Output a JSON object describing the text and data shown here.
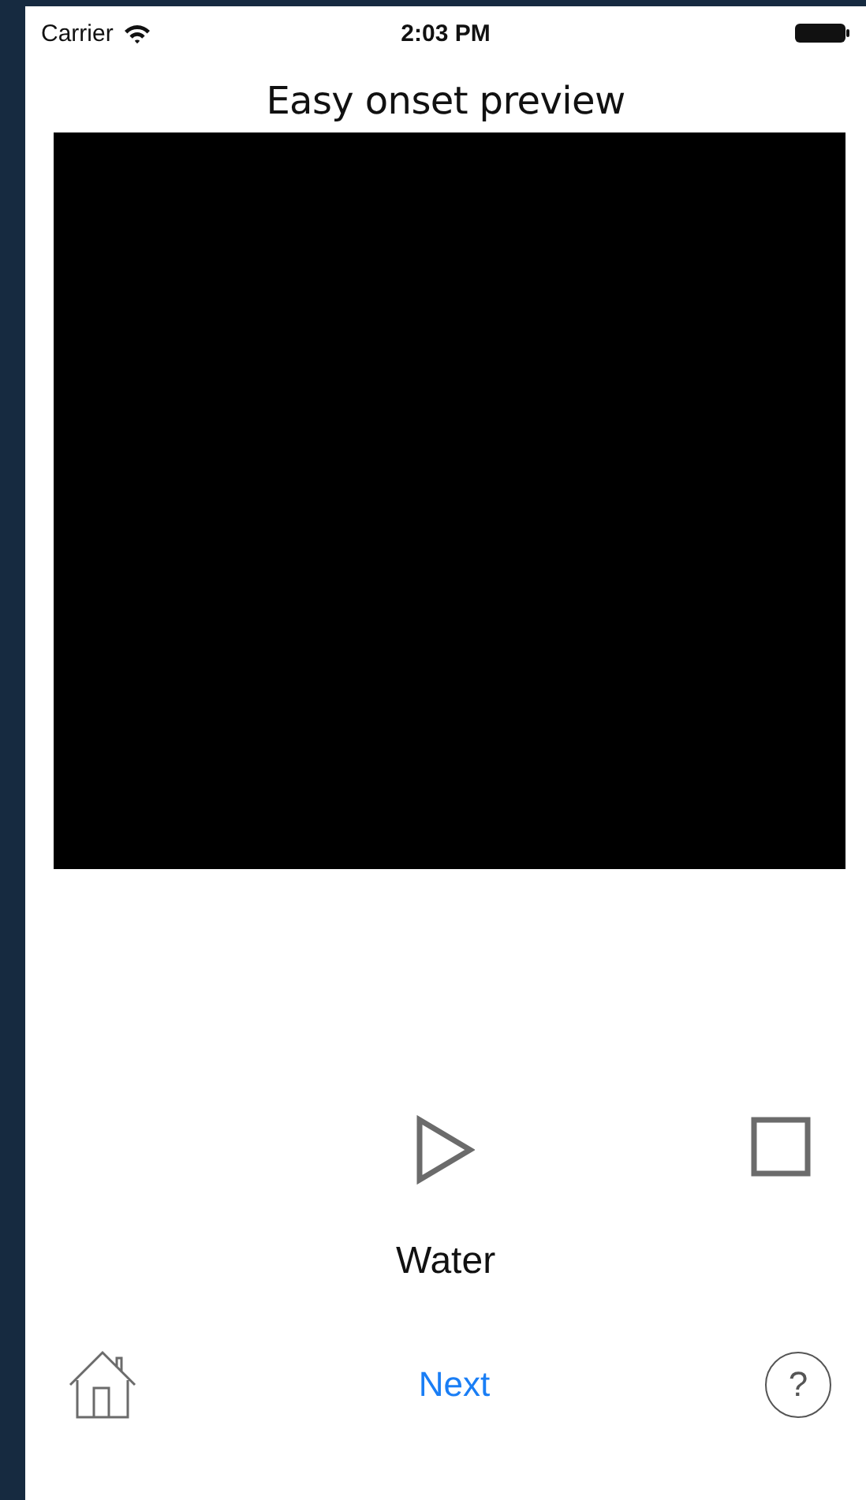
{
  "status_bar": {
    "carrier": "Carrier",
    "time": "2:03 PM"
  },
  "title": "Easy onset preview",
  "word": "Water",
  "bottom_bar": {
    "next": "Next",
    "help": "?"
  }
}
